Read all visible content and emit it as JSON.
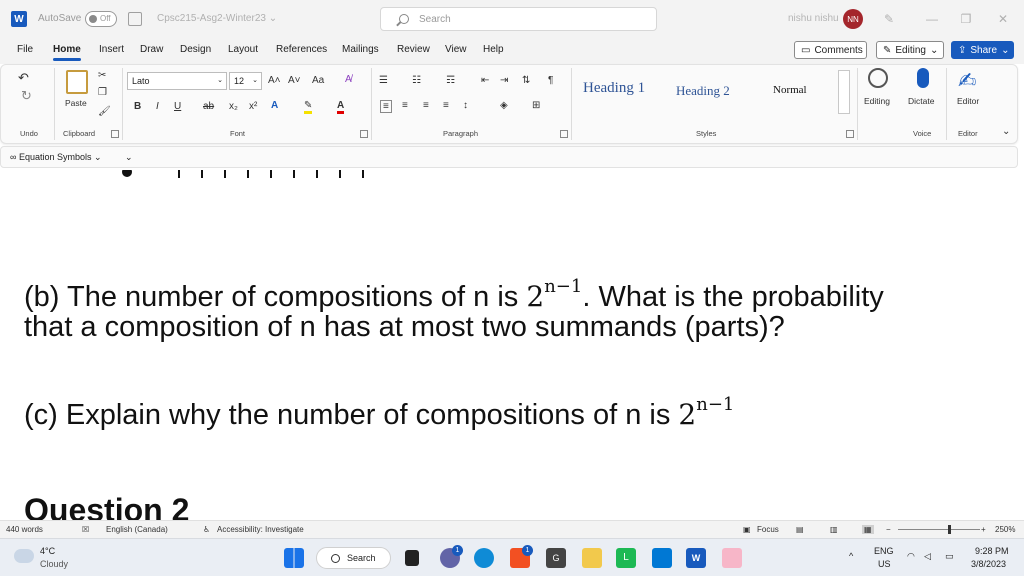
{
  "titlebar": {
    "autosave_label": "AutoSave",
    "autosave_state": "Off",
    "doc_title": "Cpsc215-Asg2-Winter23 ⌄",
    "search_placeholder": "Search",
    "user_name": "nishu nishu",
    "user_initials": "NN",
    "minimize": "—",
    "restore": "❐",
    "close": "✕"
  },
  "tabs": [
    "File",
    "Home",
    "Insert",
    "Draw",
    "Design",
    "Layout",
    "References",
    "Mailings",
    "Review",
    "View",
    "Help"
  ],
  "active_tab": "Home",
  "actions": {
    "comments": "Comments",
    "editing": "Editing",
    "share": "Share"
  },
  "ribbon": {
    "undo_label": "Undo",
    "clipboard_label": "Clipboard",
    "paste_label": "Paste",
    "font_label": "Font",
    "font_name": "Lato",
    "font_size": "12",
    "paragraph_label": "Paragraph",
    "styles_label": "Styles",
    "styles": [
      "Heading 1",
      "Heading 2",
      "Normal"
    ],
    "editing_label": "Editing",
    "dictate_label": "Dictate",
    "editor_label": "Editor",
    "voice_label": "Voice",
    "editor_group_label": "Editor",
    "font_buttons": {
      "bold": "B",
      "italic": "I",
      "underline": "U",
      "strike": "ab",
      "sub": "x₂",
      "sup": "x²",
      "grow": "A˄",
      "shrink": "A˅",
      "case": "Aa"
    }
  },
  "quick_access": {
    "equation_symbols": "Equation Symbols"
  },
  "document": {
    "para_b_line1_prefix": "(b) The number of compositions of n is ",
    "para_b_math_base": "2",
    "para_b_math_exp": "n−1",
    "para_b_line1_suffix": ". What is the probability",
    "para_b_line2": "that a composition of n has at most two summands (parts)?",
    "para_c_prefix": "(c) Explain why the number of compositions of n is ",
    "para_c_math_base": "2",
    "para_c_math_exp": "n−1",
    "question_heading": "Question 2"
  },
  "statusbar": {
    "word_count": "440 words",
    "language": "English (Canada)",
    "accessibility": "Accessibility: Investigate",
    "focus": "Focus",
    "zoom": "250%"
  },
  "taskbar": {
    "temperature": "4°C",
    "weather": "Cloudy",
    "search": "Search",
    "lang_line1": "ENG",
    "lang_line2": "US",
    "time": "9:28 PM",
    "date": "3/8/2023",
    "teams_badge": "1",
    "store_badge": "1"
  },
  "colors": {
    "word_blue": "#185abd",
    "heading_blue": "#2f5496",
    "avatar_red": "#a4262c"
  }
}
